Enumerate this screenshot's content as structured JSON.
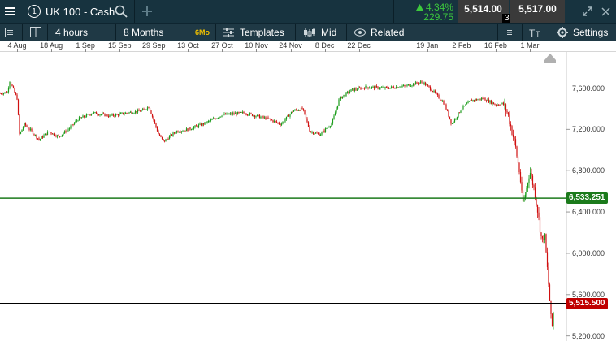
{
  "header": {
    "instrument_number": "1",
    "instrument_name": "UK 100 - Cash",
    "change_percent": "4.34%",
    "change_points": "229.75",
    "sell_price": "5,514.00",
    "buy_price": "5,517.00",
    "spread": "3.00",
    "icons": {
      "menu": "hamburger-icon",
      "search": "search-icon",
      "add": "plus-icon",
      "expand": "expand-icon",
      "close": "close-icon",
      "change_direction": "up-triangle-icon"
    }
  },
  "toolbar": {
    "interval": "4 hours",
    "range": "8 Months",
    "range_badge": "6Mo",
    "templates": "Templates",
    "price_type": "Mid",
    "related": "Related",
    "settings": "Settings"
  },
  "colors": {
    "bull": "#1a9c1a",
    "bear": "#d01010",
    "header_bg": "#17333f",
    "toolbar_bg": "#1f3945",
    "up_text": "#3dc93d",
    "level_green": "#1b7a1b",
    "level_red": "#c00000",
    "badge_bg": "#f0c000"
  },
  "chart_data": {
    "type": "candlestick",
    "x_ticks": [
      "4 Aug",
      "18 Aug",
      "1 Sep",
      "15 Sep",
      "29 Sep",
      "13 Oct",
      "27 Oct",
      "10 Nov",
      "24 Nov",
      "8 Dec",
      "22 Dec",
      "19 Jan",
      "2 Feb",
      "16 Feb",
      "1 Mar"
    ],
    "y_ticks": [
      "7,600.000",
      "7,200.000",
      "6,800.000",
      "6,400.000",
      "6,000.000",
      "5,600.000",
      "5,200.000"
    ],
    "y_tick_values": [
      7600,
      7200,
      6800,
      6400,
      6000,
      5600,
      5200
    ],
    "ylim": [
      5150,
      7950
    ],
    "levels": [
      {
        "value": 6533.251,
        "label": "6,533.251",
        "color": "#1b7a1b"
      },
      {
        "value": 5515.5,
        "label": "5,515.500",
        "color": "#c00000"
      }
    ],
    "series": [
      {
        "close_path": [
          {
            "x": "28 Jul",
            "y": 7550
          },
          {
            "x": "31 Jul",
            "y": 7560
          },
          {
            "x": "1 Aug",
            "y": 7670
          },
          {
            "x": "4 Aug",
            "y": 7500
          },
          {
            "x": "5 Aug",
            "y": 7150
          },
          {
            "x": "7 Aug",
            "y": 7250
          },
          {
            "x": "10 Aug",
            "y": 7180
          },
          {
            "x": "13 Aug",
            "y": 7100
          },
          {
            "x": "17 Aug",
            "y": 7180
          },
          {
            "x": "21 Aug",
            "y": 7130
          },
          {
            "x": "25 Aug",
            "y": 7200
          },
          {
            "x": "29 Aug",
            "y": 7300
          },
          {
            "x": "4 Sep",
            "y": 7360
          },
          {
            "x": "11 Sep",
            "y": 7330
          },
          {
            "x": "18 Sep",
            "y": 7360
          },
          {
            "x": "24 Sep",
            "y": 7380
          },
          {
            "x": "27 Sep",
            "y": 7420
          },
          {
            "x": "1 Oct",
            "y": 7150
          },
          {
            "x": "3 Oct",
            "y": 7080
          },
          {
            "x": "8 Oct",
            "y": 7180
          },
          {
            "x": "13 Oct",
            "y": 7200
          },
          {
            "x": "20 Oct",
            "y": 7260
          },
          {
            "x": "27 Oct",
            "y": 7340
          },
          {
            "x": "5 Nov",
            "y": 7360
          },
          {
            "x": "15 Nov",
            "y": 7300
          },
          {
            "x": "20 Nov",
            "y": 7250
          },
          {
            "x": "25 Nov",
            "y": 7380
          },
          {
            "x": "29 Nov",
            "y": 7400
          },
          {
            "x": "2 Dec",
            "y": 7180
          },
          {
            "x": "6 Dec",
            "y": 7150
          },
          {
            "x": "11 Dec",
            "y": 7260
          },
          {
            "x": "14 Dec",
            "y": 7500
          },
          {
            "x": "19 Dec",
            "y": 7580
          },
          {
            "x": "25 Dec",
            "y": 7610
          },
          {
            "x": "2 Jan",
            "y": 7600
          },
          {
            "x": "10 Jan",
            "y": 7620
          },
          {
            "x": "17 Jan",
            "y": 7660
          },
          {
            "x": "21 Jan",
            "y": 7580
          },
          {
            "x": "26 Jan",
            "y": 7450
          },
          {
            "x": "29 Jan",
            "y": 7250
          },
          {
            "x": "2 Feb",
            "y": 7400
          },
          {
            "x": "6 Feb",
            "y": 7480
          },
          {
            "x": "11 Feb",
            "y": 7500
          },
          {
            "x": "16 Feb",
            "y": 7440
          },
          {
            "x": "19 Feb",
            "y": 7450
          },
          {
            "x": "21 Feb",
            "y": 7350
          },
          {
            "x": "24 Feb",
            "y": 7050
          },
          {
            "x": "26 Feb",
            "y": 6750
          },
          {
            "x": "27 Feb",
            "y": 6480
          },
          {
            "x": "28 Feb",
            "y": 6550
          },
          {
            "x": "1 Mar",
            "y": 6800
          },
          {
            "x": "3 Mar",
            "y": 6600
          },
          {
            "x": "4 Mar",
            "y": 6450
          },
          {
            "x": "6 Mar",
            "y": 6100
          },
          {
            "x": "7 Mar",
            "y": 6200
          },
          {
            "x": "8 Mar",
            "y": 5900
          },
          {
            "x": "9 Mar",
            "y": 5600
          },
          {
            "x": "10 Mar",
            "y": 5250
          },
          {
            "x": "11 Mar",
            "y": 5515
          }
        ]
      }
    ]
  }
}
